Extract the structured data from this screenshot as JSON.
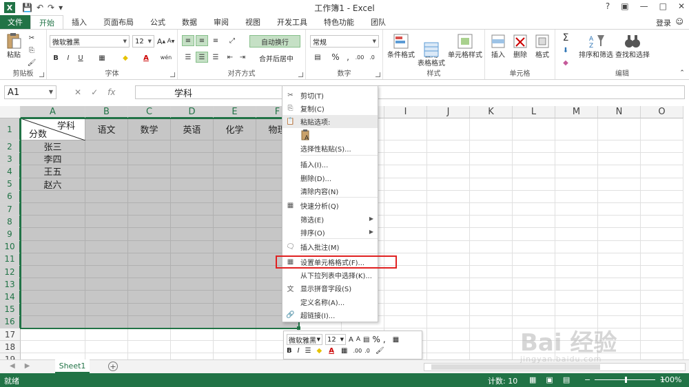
{
  "window": {
    "title": "工作簿1 - Excel",
    "controls": [
      "?",
      "▣",
      "—",
      "□",
      "✕"
    ]
  },
  "tabs": {
    "file": "文件",
    "items": [
      "开始",
      "插入",
      "页面布局",
      "公式",
      "数据",
      "审阅",
      "视图",
      "开发工具",
      "特色功能",
      "团队"
    ],
    "active": "开始",
    "login": "登录"
  },
  "ribbon": {
    "clipboard": {
      "label": "剪贴板",
      "paste": "粘贴"
    },
    "font": {
      "label": "字体",
      "name": "微软雅黑",
      "size": "12"
    },
    "alignment": {
      "label": "对齐方式",
      "wrap": "自动换行",
      "merge": "合并后居中"
    },
    "number": {
      "label": "数字",
      "format": "常规"
    },
    "styles": {
      "label": "样式",
      "cond": "条件格式",
      "table": "套用\n表格格式",
      "cellstyle": "单元格样式"
    },
    "cells": {
      "label": "单元格",
      "insert": "插入",
      "delete": "删除",
      "format": "格式"
    },
    "editing": {
      "label": "编辑",
      "sort": "排序和筛选",
      "find": "查找和选择"
    }
  },
  "formula_bar": {
    "name_box": "A1",
    "content": "学科"
  },
  "grid": {
    "columns": [
      "A",
      "B",
      "C",
      "D",
      "E",
      "F",
      "G",
      "H",
      "I",
      "J",
      "K",
      "L",
      "M",
      "N",
      "O"
    ],
    "rows": [
      "1",
      "2",
      "3",
      "4",
      "5",
      "6",
      "7",
      "8",
      "9",
      "10",
      "11",
      "12",
      "13",
      "14",
      "15",
      "16",
      "17",
      "18",
      "19"
    ],
    "a1_top": "学科",
    "a1_bottom": "分数",
    "header_row": [
      "语文",
      "数学",
      "英语",
      "化学",
      "物理"
    ],
    "names": [
      "张三",
      "李四",
      "王五",
      "赵六"
    ]
  },
  "context_menu": {
    "items": [
      {
        "label": "剪切(T)",
        "icon": "scissors-icon"
      },
      {
        "label": "复制(C)",
        "icon": "copy-icon"
      },
      {
        "label": "粘贴选项:",
        "icon": "paste-icon"
      },
      {
        "label": "选择性粘贴(S)...",
        "icon": ""
      },
      {
        "label": "插入(I)...",
        "icon": ""
      },
      {
        "label": "删除(D)...",
        "icon": ""
      },
      {
        "label": "清除内容(N)",
        "icon": ""
      },
      {
        "label": "快速分析(Q)",
        "icon": "quick-analysis-icon"
      },
      {
        "label": "筛选(E)",
        "icon": ""
      },
      {
        "label": "排序(O)",
        "icon": ""
      },
      {
        "label": "插入批注(M)",
        "icon": "comment-icon"
      },
      {
        "label": "设置单元格格式(F)...",
        "icon": "format-cells-icon"
      },
      {
        "label": "从下拉列表中选择(K)...",
        "icon": ""
      },
      {
        "label": "显示拼音字段(S)",
        "icon": "phonetic-icon"
      },
      {
        "label": "定义名称(A)...",
        "icon": ""
      },
      {
        "label": "超链接(I)...",
        "icon": "hyperlink-icon"
      }
    ]
  },
  "mini_toolbar": {
    "font": "微软雅黑",
    "size": "12"
  },
  "sheets": {
    "items": [
      "Sheet1"
    ]
  },
  "status": {
    "ready": "就绪",
    "count": "计数: 10",
    "zoom": "100%"
  },
  "watermark": {
    "main": "Bai 经验",
    "sub": "jingyan.baidu.com"
  },
  "colors": {
    "accent": "#217346",
    "selection": "#c6c6c6",
    "highlight": "#e02020"
  }
}
